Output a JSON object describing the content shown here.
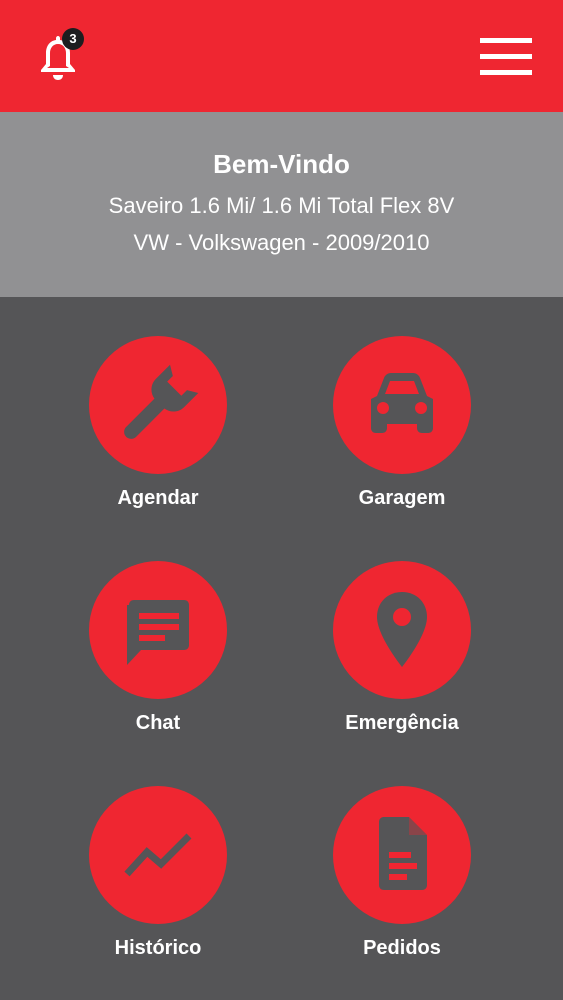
{
  "header": {
    "notification_count": "3",
    "icons": {
      "bell": "bell-icon",
      "menu": "hamburger-menu-icon"
    },
    "background_color": "#ef2631"
  },
  "welcome": {
    "title": "Bem-Vindo",
    "vehicle_model": "Saveiro 1.6 Mi/ 1.6 Mi Total Flex 8V",
    "vehicle_make_year": "VW - Volkswagen - 2009/2010",
    "background_color": "#919193"
  },
  "menu": {
    "items": [
      {
        "label": "Agendar",
        "icon": "wrench-icon"
      },
      {
        "label": "Garagem",
        "icon": "car-icon"
      },
      {
        "label": "Chat",
        "icon": "chat-icon"
      },
      {
        "label": "Emergência",
        "icon": "location-pin-icon"
      },
      {
        "label": "Histórico",
        "icon": "trend-line-icon"
      },
      {
        "label": "Pedidos",
        "icon": "document-icon"
      }
    ],
    "background_color": "#555557",
    "accent_color": "#ef2631"
  }
}
